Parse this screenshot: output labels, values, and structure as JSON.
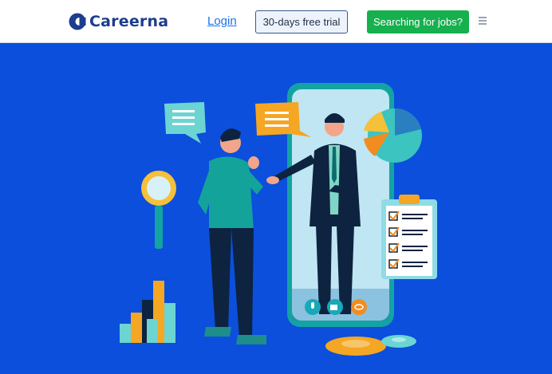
{
  "brand": {
    "name": "Careerna",
    "logo_color": "#1d3d8f"
  },
  "nav": {
    "login_label": "Login",
    "trial_label": "30-days free trial",
    "jobs_label": "Searching for jobs?",
    "menu_icon": "hamburger-icon"
  },
  "colors": {
    "hero_background": "#0b4fdc",
    "primary_button": "#16b04e",
    "link": "#1a73e8"
  },
  "hero": {
    "illustration": "job-interview-illustration",
    "phone_controls": [
      "microphone-icon",
      "video-camera-icon",
      "link-icon"
    ]
  }
}
